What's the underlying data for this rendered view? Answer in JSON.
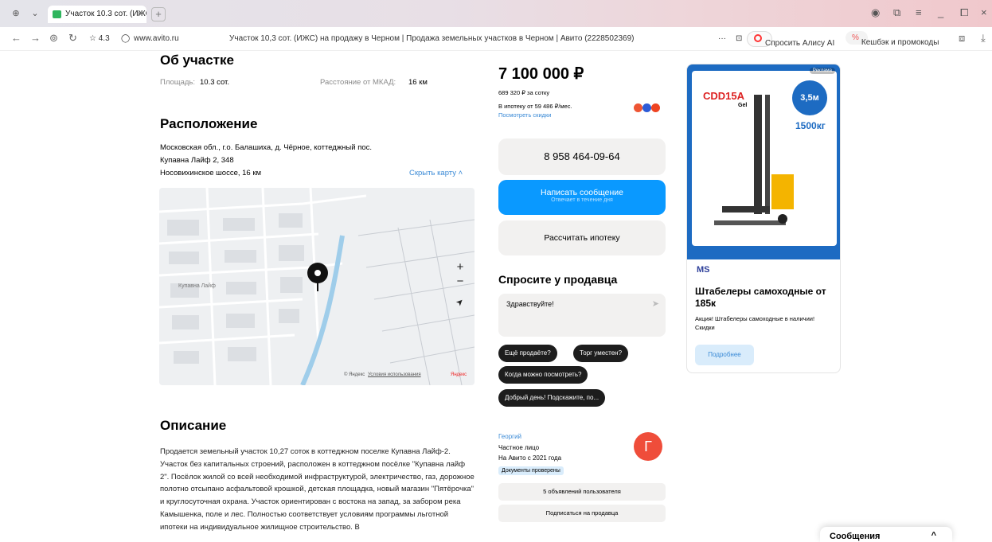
{
  "browser": {
    "tab_title": "Участок 10.3 сот. (ИЖС",
    "tab_close": "×",
    "new_tab": "+",
    "rating": "☆ 4.3",
    "domain": "www.avito.ru",
    "page_title": "Участок 10,3 сот. (ИЖС) на продажу в Черном | Продажа земельных участков в Черном | Авито (2228502369)",
    "more": "···",
    "alice_label": "Спросить Алису AI",
    "cashback_label": "Кешбэк и промокоды"
  },
  "about": {
    "title": "Об участке",
    "area_label": "Площадь:",
    "area_value": "10.3 сот.",
    "distance_label": "Расстояние от МКАД:",
    "distance_value": "16 км"
  },
  "location": {
    "title": "Расположение",
    "line1": "Московская обл., г.о. Балашиха, д. Чёрное, коттеджный пос.",
    "line2": "Купавна Лайф 2, 348",
    "line3": "Носовихинское шоссе, 16 км",
    "hide_map": "Скрыть карту ˄"
  },
  "map": {
    "zoom_in": "+",
    "zoom_out": "−",
    "locate": "➤",
    "village_label": "Купавна Лайф",
    "attribution_prefix": "© Яндекс",
    "terms": "Условия использования",
    "brand": "Яндекс"
  },
  "description": {
    "title": "Описание",
    "text": "Продается земельный участок 10,27 соток в коттеджном поселке Купавна Лайф-2. Участок без капитальных строений, расположен в коттеджном посёлке \"Купавна лайф 2\". Посёлок жилой со всей необходимой инфраструктурой, электричество, газ, дорожное полотно отсыпано асфальтовой крошкой, детская площадка, новый магазин \"Пятёрочка\" и круглосуточная охрана. Участок ориентирован с востока на запад, за забором река Камышенка, поле и лес. Полностью соответствует условиям программы льготной ипотеки на индивидуальное жилищное строительство. В"
  },
  "price": {
    "value": "7 100 000 ₽",
    "per_sotka": "689 320 ₽ за сотку",
    "mortgage": "В ипотеку от 59 486 ₽/мес.",
    "discounts": "Посмотреть скидки"
  },
  "actions": {
    "phone": "8 958 464-09-64",
    "message": "Написать сообщение",
    "message_sub": "Отвечает в течение дня",
    "mortgage": "Рассчитать ипотеку"
  },
  "ask": {
    "title": "Спросите у продавца",
    "placeholder": "Здравствуйте!",
    "chips": [
      "Ещё продаёте?",
      "Торг уместен?",
      "Когда можно посмотреть?",
      "Добрый день! Подскажите, по..."
    ]
  },
  "seller": {
    "name": "Георгий",
    "type": "Частное лицо",
    "since": "На Авито с 2021 года",
    "verified": "Документы проверены",
    "avatar_letter": "Г",
    "listings": "5 объявлений пользователя",
    "subscribe": "Подписаться на продавца"
  },
  "ad": {
    "badge": "Реклама",
    "model": "CDD15A",
    "model_sub": "Gel",
    "height": "3,5м",
    "capacity": "1500кг",
    "logo": "MS",
    "title": "Штабелеры самоходные от 185к",
    "text": "Акция! Штабелеры самоходные в наличии! Скидки",
    "button": "Подробнее"
  },
  "messages": {
    "label": "Сообщения",
    "chevron": "^"
  }
}
